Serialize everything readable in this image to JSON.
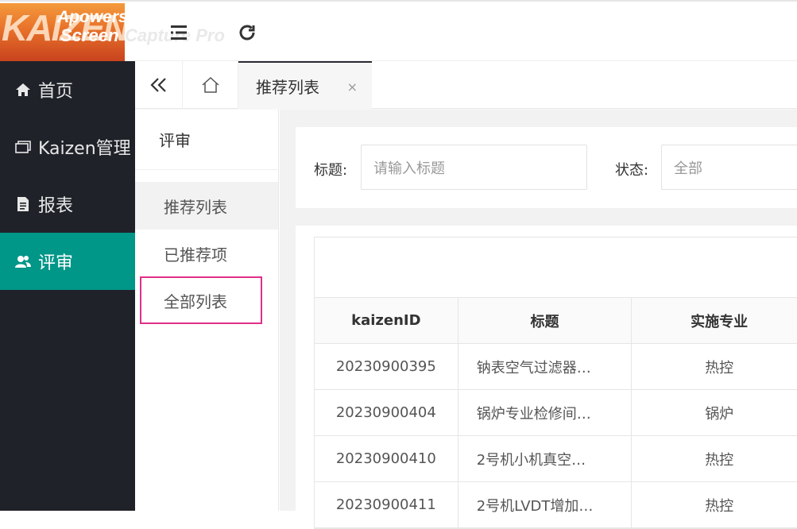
{
  "header": {
    "logo_text": "KAIZEN",
    "watermark_line1": "Apowersoft",
    "watermark_line2": "Screen Capture Pro",
    "icons": [
      "menu-icon",
      "refresh-icon"
    ]
  },
  "sidebar": {
    "items": [
      {
        "label": "首页",
        "icon": "home-icon"
      },
      {
        "label": "Kaizen管理",
        "icon": "window-icon"
      },
      {
        "label": "报表",
        "icon": "report-icon"
      },
      {
        "label": "评审",
        "icon": "users-icon",
        "active": true
      }
    ],
    "active_color": "#009688",
    "bg_color": "#20222a"
  },
  "tabs": {
    "active_label": "推荐列表",
    "close_symbol": "×"
  },
  "submenu": {
    "title": "评审",
    "items": [
      "推荐列表",
      "已推荐项",
      "全部列表"
    ],
    "highlight_color": "#e0308a"
  },
  "filter": {
    "title_label": "标题:",
    "title_placeholder": "请输入标题",
    "status_label": "状态:",
    "status_value": "全部"
  },
  "table": {
    "headers": [
      "kaizenID",
      "标题",
      "实施专业"
    ],
    "rows": [
      [
        "20230900395",
        "钠表空气过滤器…",
        "热控"
      ],
      [
        "20230900404",
        "锅炉专业检修间…",
        "锅炉"
      ],
      [
        "20230900410",
        "2号机小机真空…",
        "热控"
      ],
      [
        "20230900411",
        "2号机LVDT增加…",
        "热控"
      ]
    ]
  }
}
